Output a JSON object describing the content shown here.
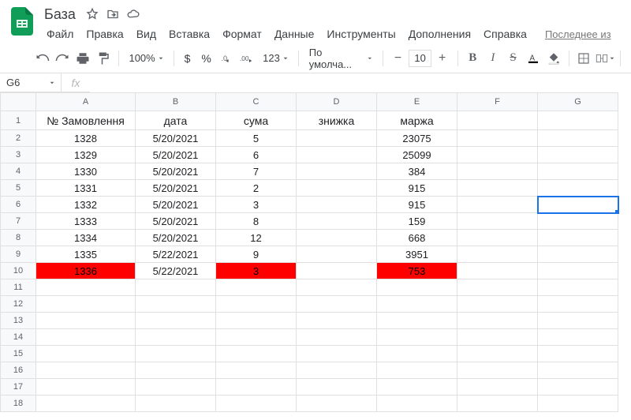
{
  "doc": {
    "title": "База"
  },
  "menus": [
    "Файл",
    "Правка",
    "Вид",
    "Вставка",
    "Формат",
    "Данные",
    "Инструменты",
    "Дополнения",
    "Справка"
  ],
  "last_edit": "Последнее из",
  "toolbar": {
    "zoom": "100%",
    "currency": "$",
    "percent": "%",
    "more_formats": "123",
    "font": "По умолча...",
    "font_size": "10",
    "bold": "B",
    "italic": "I",
    "strike": "S"
  },
  "name_box": "G6",
  "fx_label": "fx",
  "columns": [
    "A",
    "B",
    "C",
    "D",
    "E",
    "F",
    "G"
  ],
  "row_count": 18,
  "selected_cell": "G6",
  "headers": {
    "A": "№ Замовлення",
    "B": "дата",
    "C": "сума",
    "D": "знижка",
    "E": "маржа"
  },
  "rows": [
    {
      "A": "1328",
      "B": "5/20/2021",
      "C": "5",
      "D": "",
      "E": "23075",
      "hl": false
    },
    {
      "A": "1329",
      "B": "5/20/2021",
      "C": "6",
      "D": "",
      "E": "25099",
      "hl": false
    },
    {
      "A": "1330",
      "B": "5/20/2021",
      "C": "7",
      "D": "",
      "E": "384",
      "hl": false
    },
    {
      "A": "1331",
      "B": "5/20/2021",
      "C": "2",
      "D": "",
      "E": "915",
      "hl": false
    },
    {
      "A": "1332",
      "B": "5/20/2021",
      "C": "3",
      "D": "",
      "E": "915",
      "hl": false
    },
    {
      "A": "1333",
      "B": "5/20/2021",
      "C": "8",
      "D": "",
      "E": "159",
      "hl": false
    },
    {
      "A": "1334",
      "B": "5/20/2021",
      "C": "12",
      "D": "",
      "E": "668",
      "hl": false
    },
    {
      "A": "1335",
      "B": "5/22/2021",
      "C": "9",
      "D": "",
      "E": "3951",
      "hl": false
    },
    {
      "A": "1336",
      "B": "5/22/2021",
      "C": "3",
      "D": "",
      "E": "753",
      "hl": true
    }
  ]
}
